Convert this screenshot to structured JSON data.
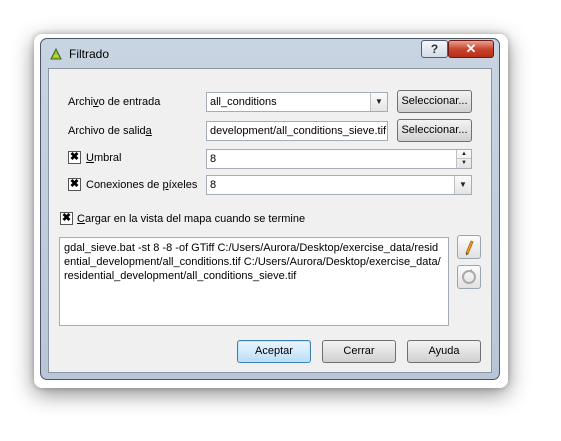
{
  "window": {
    "title": "Filtrado",
    "help_label": "?",
    "close_label": "✕"
  },
  "form": {
    "input_file_label_pre": "Archi",
    "input_file_label_ul": "v",
    "input_file_label_post": "o de entrada",
    "input_file_value": "all_conditions",
    "input_select_label": "Seleccionar...",
    "output_file_label_pre": "Archivo de salid",
    "output_file_label_ul": "a",
    "output_file_label_post": "",
    "output_file_value": "development/all_conditions_sieve.tif",
    "output_select_label": "Seleccionar...",
    "threshold_checked": true,
    "threshold_label_ul": "U",
    "threshold_label_post": "mbral",
    "threshold_value": "8",
    "pixel_connections_checked": true,
    "pixel_connections_label_pre": "Conexiones de ",
    "pixel_connections_label_ul": "p",
    "pixel_connections_label_post": "íxeles",
    "pixel_connections_value": "8",
    "load_in_map_checked": true,
    "load_in_map_label_ul": "C",
    "load_in_map_label_post": "argar en la vista del mapa cuando se termine"
  },
  "command": {
    "text": "gdal_sieve.bat -st 8 -8 -of GTiff C:/Users/Aurora/Desktop/exercise_data/residential_development/all_conditions.tif C:/Users/Aurora/Desktop/exercise_data/residential_development/all_conditions_sieve.tif"
  },
  "buttons": {
    "accept": "Aceptar",
    "close": "Cerrar",
    "help": "Ayuda"
  },
  "icons": {
    "app": "qgis-icon",
    "edit": "pencil-icon",
    "reset": "reset-icon"
  }
}
